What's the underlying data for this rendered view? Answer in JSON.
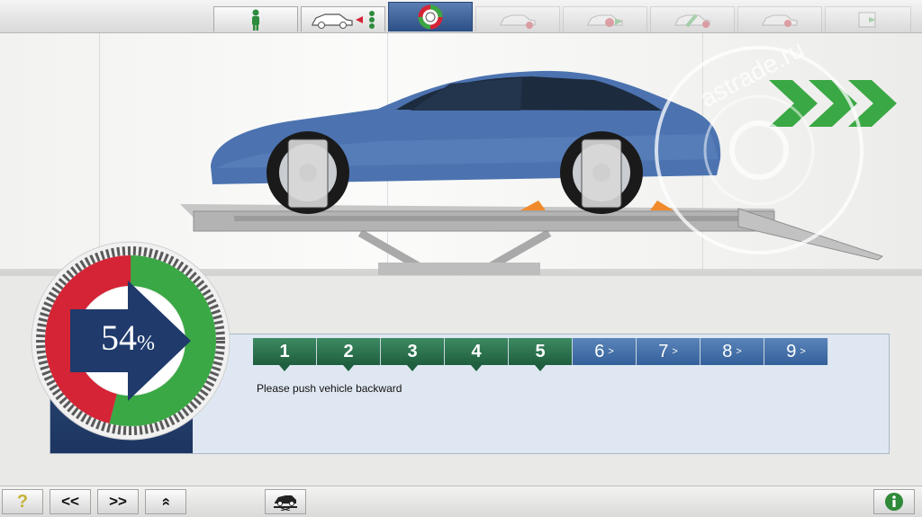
{
  "toolbar": {
    "tabs": [
      {
        "name": "operator"
      },
      {
        "name": "vehicle-selection"
      },
      {
        "name": "runout-compensation"
      },
      {
        "name": "step-4"
      },
      {
        "name": "step-5"
      },
      {
        "name": "step-6"
      },
      {
        "name": "step-7"
      },
      {
        "name": "step-8"
      }
    ]
  },
  "gauge": {
    "percent_value": "54",
    "percent_sign": "%",
    "progress": 0.54
  },
  "steps": [
    {
      "label": "1",
      "state": "done"
    },
    {
      "label": "2",
      "state": "done"
    },
    {
      "label": "3",
      "state": "done"
    },
    {
      "label": "4",
      "state": "done"
    },
    {
      "label": "5",
      "state": "done"
    },
    {
      "label": "6",
      "state": "todo"
    },
    {
      "label": "7",
      "state": "todo"
    },
    {
      "label": "8",
      "state": "todo"
    },
    {
      "label": "9",
      "state": "todo"
    }
  ],
  "chevron": ">",
  "instruction": "Please push vehicle backward",
  "watermark": {
    "text": "astrade.ru"
  },
  "bottom": {
    "help_label": "?",
    "prev_label": "<<",
    "next_label": ">>",
    "up_label": "»"
  },
  "colors": {
    "green": "#3aa844",
    "red": "#d42436",
    "navy": "#1f3a6b"
  }
}
